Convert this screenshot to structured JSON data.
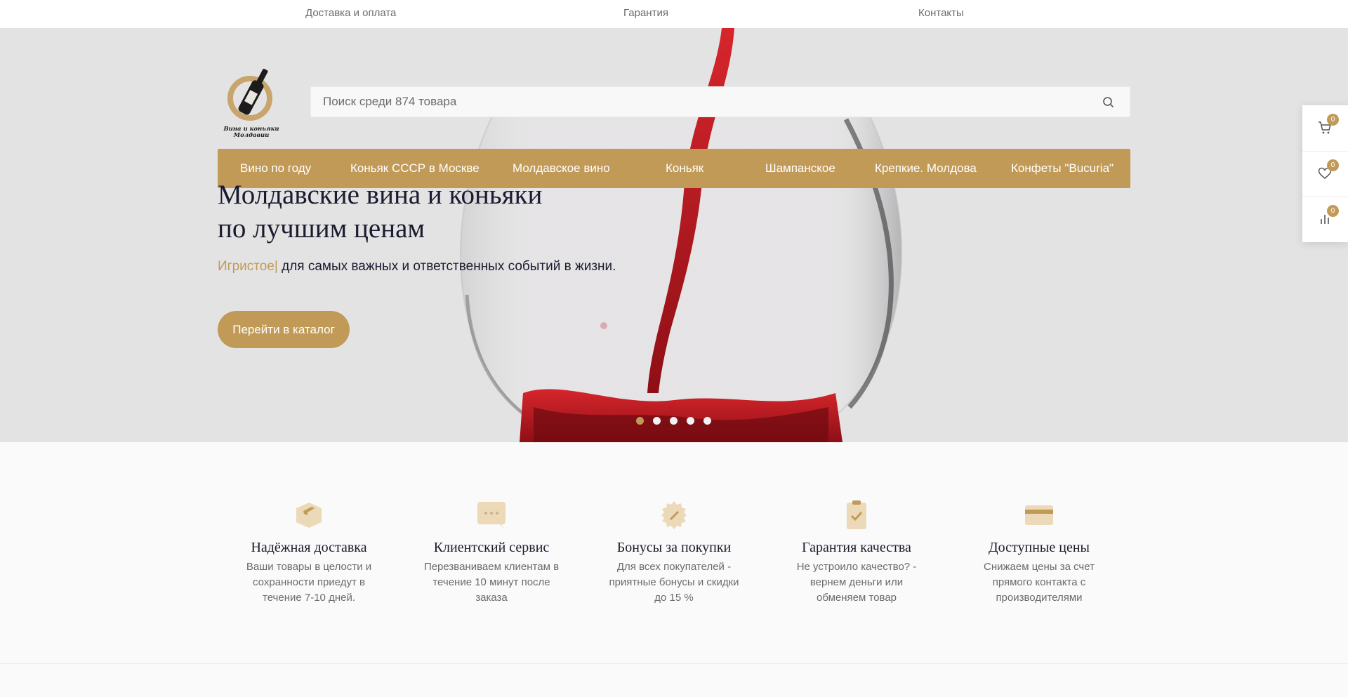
{
  "topnav": {
    "delivery": "Доставка и оплата",
    "warranty": "Гарантия",
    "contacts": "Контакты"
  },
  "logo": {
    "line1": "Вина и коньяки",
    "line2": "Молдавии"
  },
  "search": {
    "placeholder": "Поиск среди 874 товара"
  },
  "menu": {
    "items": [
      {
        "label": "Вино по году"
      },
      {
        "label": "Коньяк СССР в Москве"
      },
      {
        "label": "Молдавское вино"
      },
      {
        "label": "Коньяк"
      },
      {
        "label": "Шампанское"
      },
      {
        "label": "Крепкие. Молдова"
      },
      {
        "label": "Конфеты \"Bucuria\""
      }
    ]
  },
  "hero": {
    "title_line1": "Молдавские вина и коньяки",
    "title_line2": "по лучшим ценам",
    "typed_word": "Игристое|",
    "tagline_rest": " для самых важных и ответственных событий в жизни.",
    "cta": "Перейти в каталог",
    "slides": 5,
    "active_slide": 1
  },
  "sidewidget": {
    "cart_count": "0",
    "favorites_count": "0",
    "compare_count": "0"
  },
  "features": [
    {
      "title": "Надёжная доставка",
      "text": "Ваши товары в целости и сохранности приедут в течение 7-10 дней."
    },
    {
      "title": "Клиентский сервис",
      "text": "Перезваниваем клиентам в течение 10 минут после заказа"
    },
    {
      "title": "Бонусы за покупки",
      "text": "Для всех покупателей - приятные бонусы и скидки до 15 %"
    },
    {
      "title": "Гарантия качества",
      "text": "Не устроило качество? - вернем деньги или обменяем товар"
    },
    {
      "title": "Доступные цены",
      "text": "Снижаем цены за счет прямого контакта с производителями"
    }
  ],
  "colors": {
    "accent": "#c29a57",
    "hero_bg": "#e4e3e4",
    "wine": "#b3161b",
    "text_dark": "#1a1b2e",
    "text_muted": "#6b6b6b"
  }
}
